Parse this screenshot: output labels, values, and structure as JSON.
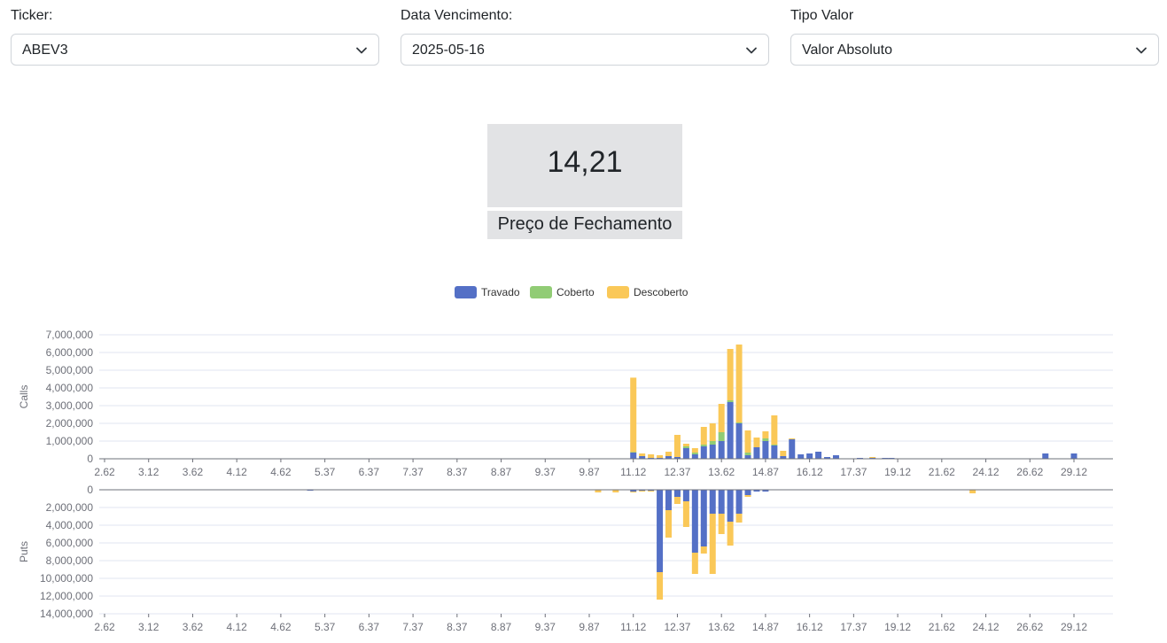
{
  "filters": {
    "ticker": {
      "label": "Ticker:",
      "value": "ABEV3"
    },
    "expiry": {
      "label": "Data Vencimento:",
      "value": "2025-05-16"
    },
    "value_type": {
      "label": "Tipo Valor",
      "value": "Valor Absoluto"
    }
  },
  "kpi": {
    "value": "14,21",
    "label": "Preço de Fechamento"
  },
  "chart_data": {
    "type": "bar",
    "stacked": true,
    "legend": {
      "position": "top-center",
      "entries": [
        "Travado",
        "Coberto",
        "Descoberto"
      ]
    },
    "colors": {
      "Travado": "#5470c6",
      "Coberto": "#91cc75",
      "Descoberto": "#fac858"
    },
    "x_ticks": [
      "2.62",
      "3.12",
      "3.62",
      "4.12",
      "4.62",
      "5.37",
      "6.37",
      "7.37",
      "8.37",
      "8.87",
      "9.37",
      "9.87",
      "11.12",
      "12.37",
      "13.62",
      "14.87",
      "16.12",
      "17.37",
      "19.12",
      "21.62",
      "24.12",
      "26.62",
      "29.12"
    ],
    "calls": {
      "ylabel": "Calls",
      "ylim": [
        0,
        7000000
      ],
      "yticks": [
        "0",
        "1,000,000",
        "2,000,000",
        "3,000,000",
        "4,000,000",
        "5,000,000",
        "6,000,000",
        "7,000,000"
      ],
      "bars": [
        {
          "strike": "11.12",
          "Travado": 350000,
          "Coberto": 30000,
          "Descoberto": 4200000
        },
        {
          "strike": "11.37",
          "Travado": 150000,
          "Coberto": 0,
          "Descoberto": 150000
        },
        {
          "strike": "11.62",
          "Travado": 50000,
          "Coberto": 0,
          "Descoberto": 200000
        },
        {
          "strike": "11.87",
          "Travado": 50000,
          "Coberto": 0,
          "Descoberto": 150000
        },
        {
          "strike": "12.12",
          "Travado": 150000,
          "Coberto": 0,
          "Descoberto": 250000
        },
        {
          "strike": "12.37",
          "Travado": 100000,
          "Coberto": 0,
          "Descoberto": 1250000
        },
        {
          "strike": "12.62",
          "Travado": 600000,
          "Coberto": 100000,
          "Descoberto": 150000
        },
        {
          "strike": "12.87",
          "Travado": 250000,
          "Coberto": 100000,
          "Descoberto": 250000
        },
        {
          "strike": "13.12",
          "Travado": 700000,
          "Coberto": 100000,
          "Descoberto": 1000000
        },
        {
          "strike": "13.37",
          "Travado": 800000,
          "Coberto": 200000,
          "Descoberto": 1000000
        },
        {
          "strike": "13.62",
          "Travado": 1000000,
          "Coberto": 500000,
          "Descoberto": 1600000
        },
        {
          "strike": "13.87",
          "Travado": 3200000,
          "Coberto": 100000,
          "Descoberto": 2900000
        },
        {
          "strike": "14.12",
          "Travado": 2000000,
          "Coberto": 50000,
          "Descoberto": 4400000
        },
        {
          "strike": "14.37",
          "Travado": 200000,
          "Coberto": 150000,
          "Descoberto": 1250000
        },
        {
          "strike": "14.62",
          "Travado": 650000,
          "Coberto": 0,
          "Descoberto": 550000
        },
        {
          "strike": "14.87",
          "Travado": 1000000,
          "Coberto": 150000,
          "Descoberto": 400000
        },
        {
          "strike": "15.12",
          "Travado": 750000,
          "Coberto": 50000,
          "Descoberto": 1650000
        },
        {
          "strike": "15.37",
          "Travado": 150000,
          "Coberto": 0,
          "Descoberto": 300000
        },
        {
          "strike": "15.62",
          "Travado": 1100000,
          "Coberto": 0,
          "Descoberto": 50000
        },
        {
          "strike": "15.87",
          "Travado": 250000,
          "Coberto": 0,
          "Descoberto": 0
        },
        {
          "strike": "16.12",
          "Travado": 300000,
          "Coberto": 0,
          "Descoberto": 0
        },
        {
          "strike": "16.37",
          "Travado": 400000,
          "Coberto": 0,
          "Descoberto": 0
        },
        {
          "strike": "16.62",
          "Travado": 100000,
          "Coberto": 0,
          "Descoberto": 0
        },
        {
          "strike": "16.87",
          "Travado": 200000,
          "Coberto": 0,
          "Descoberto": 0
        },
        {
          "strike": "17.62",
          "Travado": 50000,
          "Coberto": 0,
          "Descoberto": 0
        },
        {
          "strike": "18.12",
          "Travado": 50000,
          "Coberto": 0,
          "Descoberto": 50000
        },
        {
          "strike": "18.62",
          "Travado": 50000,
          "Coberto": 0,
          "Descoberto": 0
        },
        {
          "strike": "18.87",
          "Travado": 50000,
          "Coberto": 0,
          "Descoberto": 0
        },
        {
          "strike": "27.50",
          "Travado": 300000,
          "Coberto": 0,
          "Descoberto": 0
        },
        {
          "strike": "29.12",
          "Travado": 300000,
          "Coberto": 0,
          "Descoberto": 0
        }
      ]
    },
    "puts": {
      "ylabel": "Puts",
      "ylim": [
        0,
        14000000
      ],
      "yticks": [
        "0",
        "2,000,000",
        "4,000,000",
        "6,000,000",
        "8,000,000",
        "10,000,000",
        "12,000,000",
        "14,000,000"
      ],
      "bars": [
        {
          "strike": "5.12",
          "Travado": 100000,
          "Coberto": 0,
          "Descoberto": 0
        },
        {
          "strike": "10.12",
          "Travado": 0,
          "Coberto": 0,
          "Descoberto": 300000
        },
        {
          "strike": "10.62",
          "Travado": 0,
          "Coberto": 0,
          "Descoberto": 300000
        },
        {
          "strike": "11.12",
          "Travado": 200000,
          "Coberto": 0,
          "Descoberto": 100000
        },
        {
          "strike": "11.37",
          "Travado": 100000,
          "Coberto": 0,
          "Descoberto": 100000
        },
        {
          "strike": "11.62",
          "Travado": 100000,
          "Coberto": 0,
          "Descoberto": 100000
        },
        {
          "strike": "11.87",
          "Travado": 9300000,
          "Coberto": 0,
          "Descoberto": 3100000
        },
        {
          "strike": "12.12",
          "Travado": 2300000,
          "Coberto": 0,
          "Descoberto": 3100000
        },
        {
          "strike": "12.37",
          "Travado": 800000,
          "Coberto": 0,
          "Descoberto": 800000
        },
        {
          "strike": "12.62",
          "Travado": 1300000,
          "Coberto": 0,
          "Descoberto": 2900000
        },
        {
          "strike": "12.87",
          "Travado": 7100000,
          "Coberto": 0,
          "Descoberto": 2400000
        },
        {
          "strike": "13.12",
          "Travado": 6400000,
          "Coberto": 0,
          "Descoberto": 800000
        },
        {
          "strike": "13.37",
          "Travado": 2700000,
          "Coberto": 0,
          "Descoberto": 6800000
        },
        {
          "strike": "13.62",
          "Travado": 2700000,
          "Coberto": 0,
          "Descoberto": 2300000
        },
        {
          "strike": "13.87",
          "Travado": 3600000,
          "Coberto": 0,
          "Descoberto": 2700000
        },
        {
          "strike": "14.12",
          "Travado": 2700000,
          "Coberto": 0,
          "Descoberto": 1000000
        },
        {
          "strike": "14.37",
          "Travado": 600000,
          "Coberto": 0,
          "Descoberto": 200000
        },
        {
          "strike": "14.62",
          "Travado": 200000,
          "Coberto": 0,
          "Descoberto": 0
        },
        {
          "strike": "14.87",
          "Travado": 200000,
          "Coberto": 0,
          "Descoberto": 0
        },
        {
          "strike": "23.37",
          "Travado": 0,
          "Coberto": 0,
          "Descoberto": 400000
        }
      ]
    }
  }
}
